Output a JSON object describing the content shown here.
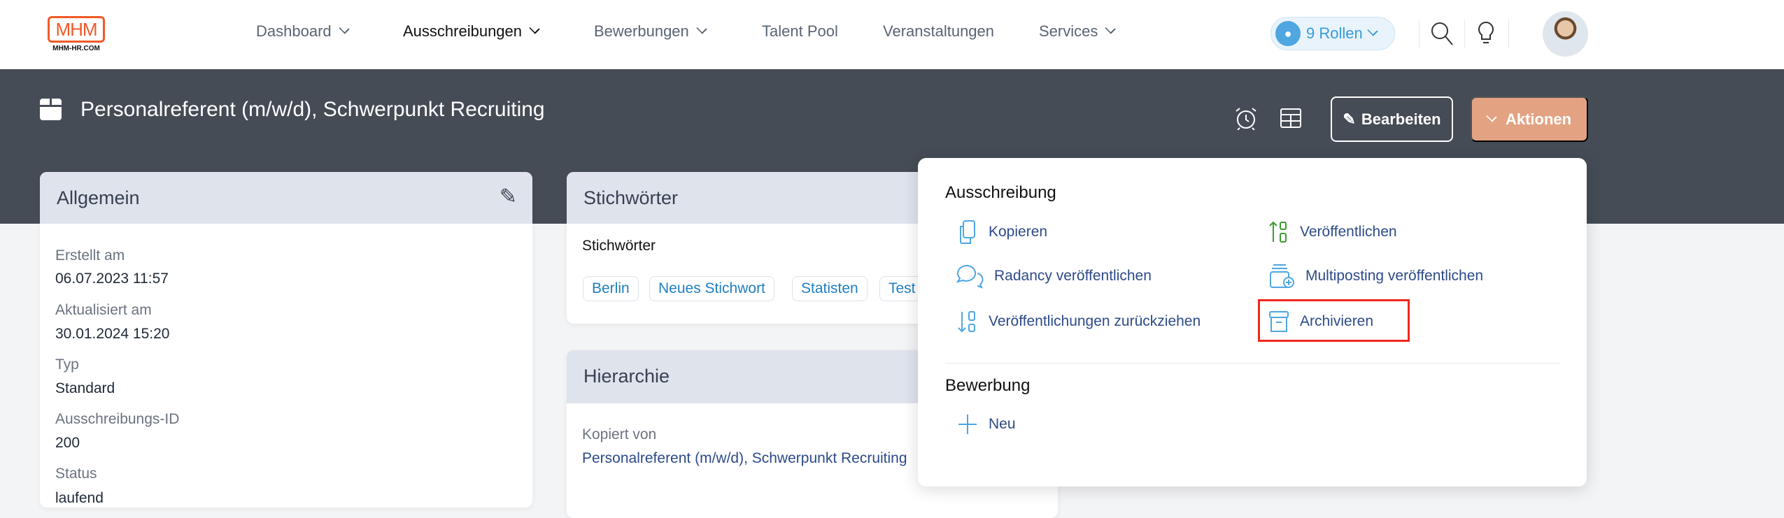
{
  "nav": {
    "logo_text": "MHM",
    "logo_sub": "MHM-HR.COM",
    "items": [
      {
        "label": "Dashboard"
      },
      {
        "label": "Ausschreibungen"
      },
      {
        "label": "Bewerbungen"
      },
      {
        "label": "Talent Pool"
      },
      {
        "label": "Veranstaltungen"
      },
      {
        "label": "Services"
      }
    ],
    "roles": "9 Rollen"
  },
  "header": {
    "title": "Personalreferent (m/w/d), Schwerpunkt Recruiting",
    "edit": "Bearbeiten",
    "actions": "Aktionen"
  },
  "general": {
    "title": "Allgemein",
    "fields": [
      {
        "label": "Erstellt am",
        "value": "06.07.2023 11:57"
      },
      {
        "label": "Aktualisiert am",
        "value": "30.01.2024 15:20"
      },
      {
        "label": "Typ",
        "value": "Standard"
      },
      {
        "label": "Ausschreibungs-ID",
        "value": "200"
      },
      {
        "label": "Status",
        "value": "laufend"
      }
    ]
  },
  "keywords": {
    "title": "Stichwörter",
    "label": "Stichwörter",
    "tags": [
      "Berlin",
      "Neues Stichwort",
      "Statisten",
      "Test"
    ]
  },
  "hierarchy": {
    "title": "Hierarchie",
    "label": "Kopiert von",
    "link": "Personalreferent (m/w/d), Schwerpunkt Recruiting"
  },
  "menu": {
    "section1": "Ausschreibung",
    "items": [
      "Kopieren",
      "Veröffentlichen",
      "Radancy veröffentlichen",
      "Multiposting veröffentlichen",
      "Veröffentlichungen zurückziehen",
      "Archivieren"
    ],
    "section2": "Bewerbung",
    "new": "Neu"
  },
  "colors": {
    "accent": "#e3a383",
    "banner": "#454c56",
    "highlight": "#f0281e",
    "link": "#2d4a8a",
    "icon_blue": "#4fa6e0",
    "icon_green": "#3c9a2e"
  }
}
